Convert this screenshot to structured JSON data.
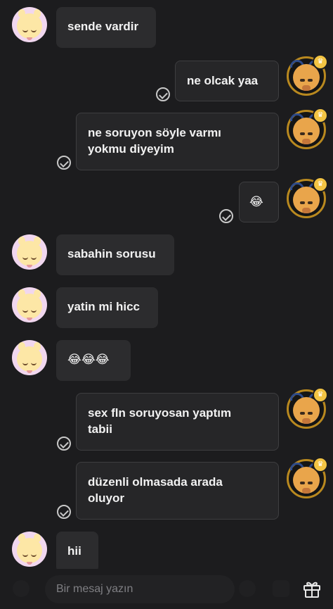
{
  "messages": [
    {
      "side": "in",
      "text": "sende vardir"
    },
    {
      "side": "out",
      "text": "ne olcak yaa"
    },
    {
      "side": "out",
      "text": "ne soruyon söyle varmı\nyokmu diyeyim"
    },
    {
      "side": "out",
      "text": "😂"
    },
    {
      "side": "in",
      "text": "sabahin sorusu"
    },
    {
      "side": "in",
      "text": "yatin mi hicc"
    },
    {
      "side": "in",
      "text": "😂😂😂"
    },
    {
      "side": "out",
      "text": "sex fln soruyosan yaptım\ntabii"
    },
    {
      "side": "out",
      "text": "düzenli olmasada arada\noluyor"
    },
    {
      "side": "in",
      "text": "hii"
    }
  ],
  "input": {
    "placeholder": "Bir mesaj yazın"
  },
  "icons": {
    "sent": "checkmark-circle-icon",
    "gift": "gift-icon",
    "crown": "crown-icon"
  },
  "colors": {
    "background": "#1c1c1e",
    "bubble": "#2c2c2e",
    "accent_ring": "#b9891f"
  }
}
